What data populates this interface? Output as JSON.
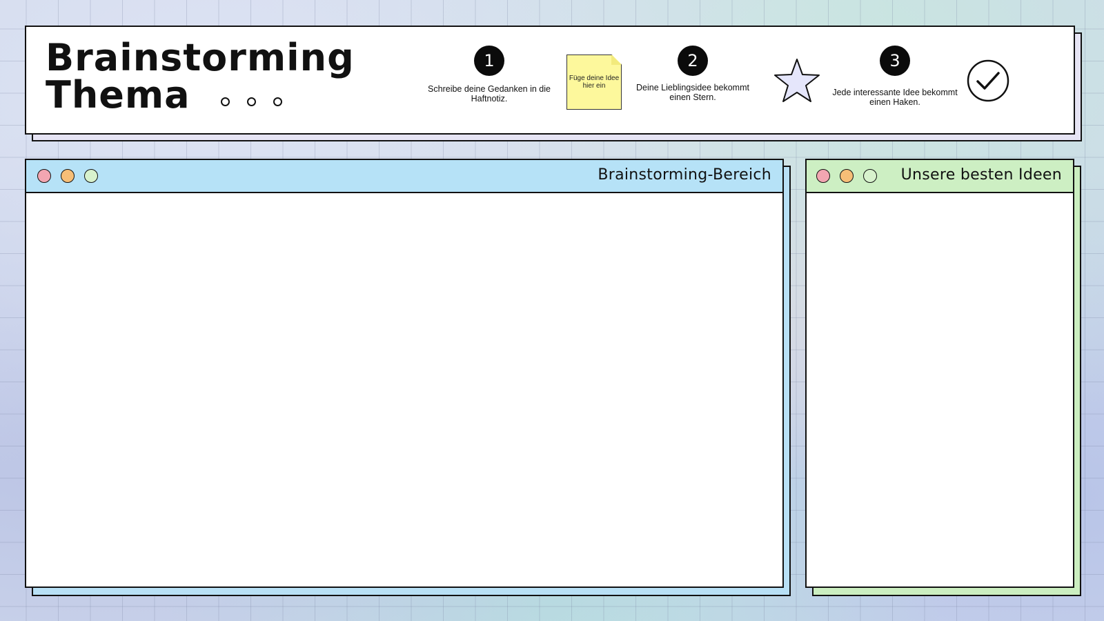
{
  "header": {
    "title_line1": "Brainstorming",
    "title_line2": "Thema",
    "steps": [
      {
        "number": "1",
        "text": "Schreibe deine Gedanken in die Haftnotiz."
      },
      {
        "number": "2",
        "text": "Deine Lieblingsidee bekommt einen Stern."
      },
      {
        "number": "3",
        "text": "Jede interessante Idee bekommt einen Haken."
      }
    ],
    "sticky_note": "Füge deine Idee hier ein",
    "icons": [
      "sticky-note-icon",
      "star-icon",
      "checkmark-icon"
    ]
  },
  "windows": {
    "brainstorm": {
      "title": "Brainstorming-Bereich",
      "color": "#b6e2f7"
    },
    "best_ideas": {
      "title": "Unsere besten Ideen",
      "color": "#cdefc3"
    }
  },
  "colors": {
    "dot_red": "#f2a6b1",
    "dot_orange": "#f6be77",
    "dot_green": "#d8f2cd",
    "sticky": "#fdf89c",
    "star_fill": "#e5e6fb"
  }
}
